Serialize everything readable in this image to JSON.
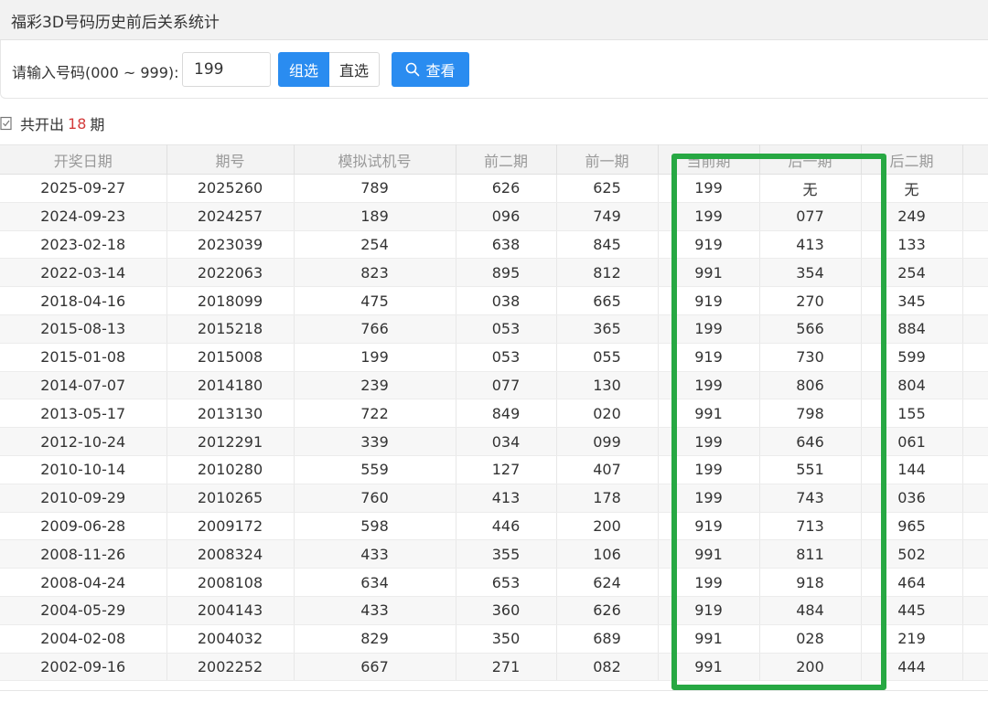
{
  "window": {
    "title": "福彩3D号码历史前后关系统计"
  },
  "search": {
    "label": "请输入号码(000 ~ 999):",
    "value": "199",
    "mode_group": "组选",
    "mode_direct": "直选",
    "query_label": "查看"
  },
  "summary": {
    "prefix": "共开出",
    "count": "18",
    "suffix": "期"
  },
  "table": {
    "headers": [
      "开奖日期",
      "期号",
      "模拟试机号",
      "前二期",
      "前一期",
      "当前期",
      "后一期",
      "后二期",
      ""
    ],
    "rows": [
      [
        "2025-09-27",
        "2025260",
        "789",
        "626",
        "625",
        "199",
        "无",
        "无"
      ],
      [
        "2024-09-23",
        "2024257",
        "189",
        "096",
        "749",
        "199",
        "077",
        "249"
      ],
      [
        "2023-02-18",
        "2023039",
        "254",
        "638",
        "845",
        "919",
        "413",
        "133"
      ],
      [
        "2022-03-14",
        "2022063",
        "823",
        "895",
        "812",
        "991",
        "354",
        "254"
      ],
      [
        "2018-04-16",
        "2018099",
        "475",
        "038",
        "665",
        "919",
        "270",
        "345"
      ],
      [
        "2015-08-13",
        "2015218",
        "766",
        "053",
        "365",
        "199",
        "566",
        "884"
      ],
      [
        "2015-01-08",
        "2015008",
        "199",
        "053",
        "055",
        "919",
        "730",
        "599"
      ],
      [
        "2014-07-07",
        "2014180",
        "239",
        "077",
        "130",
        "199",
        "806",
        "804"
      ],
      [
        "2013-05-17",
        "2013130",
        "722",
        "849",
        "020",
        "991",
        "798",
        "155"
      ],
      [
        "2012-10-24",
        "2012291",
        "339",
        "034",
        "099",
        "199",
        "646",
        "061"
      ],
      [
        "2010-10-14",
        "2010280",
        "559",
        "127",
        "407",
        "199",
        "551",
        "144"
      ],
      [
        "2010-09-29",
        "2010265",
        "760",
        "413",
        "178",
        "199",
        "743",
        "036"
      ],
      [
        "2009-06-28",
        "2009172",
        "598",
        "446",
        "200",
        "919",
        "713",
        "965"
      ],
      [
        "2008-11-26",
        "2008324",
        "433",
        "355",
        "106",
        "991",
        "811",
        "502"
      ],
      [
        "2008-04-24",
        "2008108",
        "634",
        "653",
        "624",
        "199",
        "918",
        "464"
      ],
      [
        "2004-05-29",
        "2004143",
        "433",
        "360",
        "626",
        "919",
        "484",
        "445"
      ],
      [
        "2004-02-08",
        "2004032",
        "829",
        "350",
        "689",
        "991",
        "028",
        "219"
      ],
      [
        "2002-09-16",
        "2002252",
        "667",
        "271",
        "082",
        "991",
        "200",
        "444"
      ]
    ]
  },
  "colors": {
    "accent": "#2a8cf0",
    "count_red": "#d33a3a",
    "highlight_green": "#27a843"
  }
}
